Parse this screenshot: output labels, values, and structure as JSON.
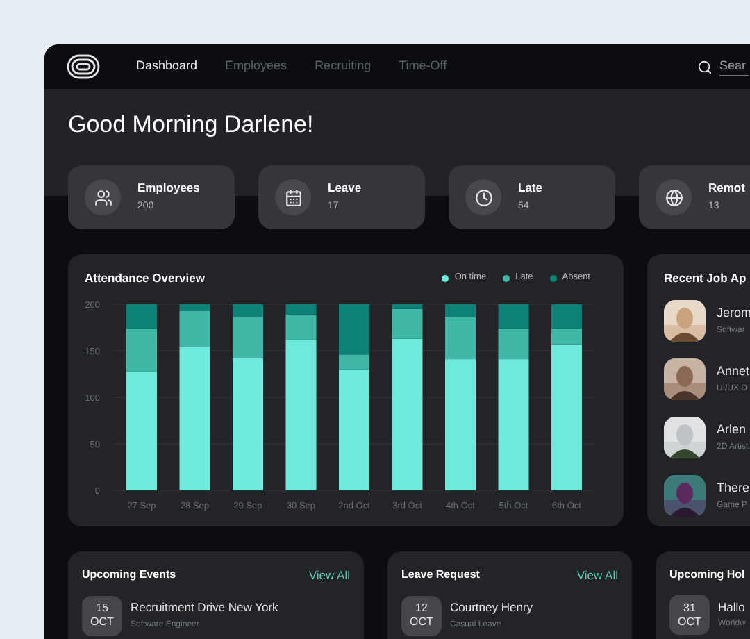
{
  "nav": {
    "tabs": [
      {
        "label": "Dashboard",
        "selected": true
      },
      {
        "label": "Employees",
        "selected": false
      },
      {
        "label": "Recruiting",
        "selected": false
      },
      {
        "label": "Time-Off",
        "selected": false
      }
    ],
    "search": {
      "placeholder": "Sear"
    }
  },
  "greeting": "Good Morning Darlene!",
  "stats": [
    {
      "kind": "people",
      "label": "Employees",
      "value": "200"
    },
    {
      "kind": "calendar",
      "label": "Leave",
      "value": "17"
    },
    {
      "kind": "clock",
      "label": "Late",
      "value": "54"
    },
    {
      "kind": "globe",
      "label": "Remot",
      "value": "13"
    }
  ],
  "attendance": {
    "title": "Attendance Overview",
    "chart_data": {
      "type": "bar",
      "stacked": true,
      "orientation": "vertical",
      "categories": [
        "27 Sep",
        "28 Sep",
        "29 Sep",
        "30 Sep",
        "2nd Oct",
        "3rd Oct",
        "4th Oct",
        "5th Oct",
        "6th Oct"
      ],
      "ylim": [
        0,
        200
      ],
      "grid": true,
      "yticks": [
        0,
        50,
        100,
        150,
        200
      ],
      "series": [
        {
          "name": "On time",
          "color": "#6eeadb",
          "values": [
            128,
            154,
            142,
            162,
            130,
            163,
            141,
            141,
            157
          ]
        },
        {
          "name": "Late",
          "color": "#3fb8a8",
          "values": [
            46,
            39,
            45,
            27,
            16,
            32,
            45,
            33,
            17
          ]
        },
        {
          "name": "Absent",
          "color": "#0b8275",
          "values": [
            26,
            7,
            13,
            11,
            54,
            5,
            14,
            26,
            26
          ]
        }
      ]
    }
  },
  "applicants": {
    "title": "Recent Job Ap",
    "items": [
      {
        "name": "Jerom",
        "role": "Softwar",
        "kind": "picture"
      },
      {
        "name": "Annet",
        "role": "UI/UX D",
        "kind": "picture"
      },
      {
        "name": "Arlen",
        "role": "2D Artist",
        "kind": "picture"
      },
      {
        "name": "There",
        "role": "Game P",
        "kind": "picture"
      }
    ]
  },
  "panels": [
    {
      "title": "Upcoming Events",
      "link": "View All",
      "day": "15",
      "month": "OCT",
      "name": "Recruitment Drive New York",
      "detail": "Software Engineer"
    },
    {
      "title": "Leave Request",
      "link": "View All",
      "day": "12",
      "month": "OCT",
      "name": "Courtney Henry",
      "detail": "Casual Leave"
    },
    {
      "title": "Upcoming Hol",
      "day": "31",
      "month": "OCT",
      "name": "Hallo",
      "detail": "Worldw"
    }
  ]
}
